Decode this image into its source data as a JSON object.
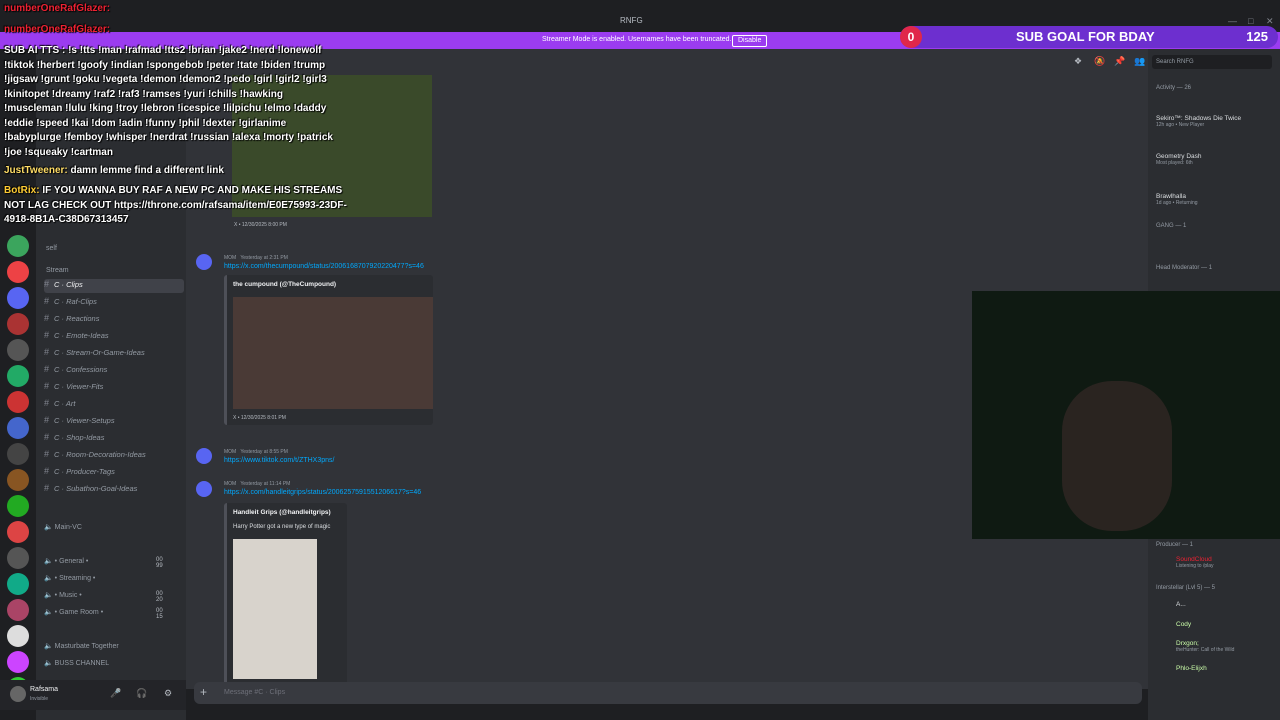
{
  "window": {
    "title": "RNFG"
  },
  "streamer_bar": {
    "message": "Streamer Mode is enabled. Usernames have been truncated.",
    "disable_label": "Disable"
  },
  "sub_goal": {
    "count": "0",
    "label": "SUB GOAL FOR BDAY",
    "target": "125"
  },
  "search": {
    "placeholder": "Search RNFG"
  },
  "stream_chat": [
    {
      "name": "numberOneRafGlazer:",
      "text": ""
    },
    {
      "name": "numberOneRafGlazer:",
      "text": ""
    },
    {
      "name": "",
      "text": "SUB AI TTS : !s !tts !man !rafmad !tts2 !brian !jake2 !nerd !lonewolf !tiktok !herbert !goofy !indian !spongebob !peter !tate !biden !trump !jigsaw !grunt !goku !vegeta !demon !demon2 !pedo !girl !girl2 !girl3 !kinitopet !dreamy !raf2 !raf3 !ramses !yuri !chills !hawking !muscleman !lulu !king !troy !lebron !icespice !lilpichu !elmo !daddy !eddie !speed !kai !dom !adin !funny !phil !dexter !girlanime !babyplurge !femboy !whisper !nerdrat !russian !alexa !morty !patrick !joe !squeaky !cartman"
    },
    {
      "name": "JustTweener:",
      "text": "damn lemme find a different link"
    },
    {
      "name": "BotRix:",
      "text": "IF YOU WANNA BUY RAF A NEW PC AND MAKE HIS STREAMS NOT LAG CHECK OUT https://throne.com/rafsama/item/E0E75993-23DF-4918-8B1A-C38D67313457"
    }
  ],
  "sidebar": {
    "self_label": "self",
    "stream_category": "Stream",
    "channels": [
      {
        "label": "C · Clips",
        "active": true
      },
      {
        "label": "C · Raf-Clips",
        "active": false
      },
      {
        "label": "C · Reactions",
        "active": false
      },
      {
        "label": "C · Emote-Ideas",
        "active": false
      },
      {
        "label": "C · Stream-Or-Game-Ideas",
        "active": false
      },
      {
        "label": "C · Confessions",
        "active": false
      },
      {
        "label": "C · Viewer-Fits",
        "active": false
      },
      {
        "label": "C · Art",
        "active": false
      },
      {
        "label": "C · Viewer-Setups",
        "active": false
      },
      {
        "label": "C · Shop-Ideas",
        "active": false
      },
      {
        "label": "C · Room-Decoration-Ideas",
        "active": false
      },
      {
        "label": "C · Producer-Tags",
        "active": false
      },
      {
        "label": "C · Subathon-Goal-Ideas",
        "active": false
      }
    ],
    "voice": [
      {
        "label": "Main-VC",
        "count": ""
      },
      {
        "label": "• General •",
        "count": "00  99"
      },
      {
        "label": "• Streaming •",
        "count": ""
      },
      {
        "label": "• Music •",
        "count": "00  20"
      },
      {
        "label": "• Game Room •",
        "count": "00  15"
      },
      {
        "label": "Masturbate Together",
        "count": ""
      },
      {
        "label": "BUSS CHANNEL",
        "count": ""
      }
    ],
    "user": {
      "name": "Rafsama",
      "status": "Invisible"
    }
  },
  "messages": [
    {
      "role": "MOM",
      "time": "Yesterday at 2:31 PM",
      "url": "https://x.com/thecumpound/status/2006168707920220477?s=46",
      "embed_title": "the cumpound (@TheCumpound)",
      "embed_footer": "X • 12/30/2025 8:01 PM"
    },
    {
      "role": "MOM",
      "time": "Yesterday at 8:55 PM",
      "url": "https://www.tiktok.com/t/ZTHX3pns/"
    },
    {
      "role": "MOM",
      "time": "Yesterday at 11:14 PM",
      "url": "https://x.com/handleitgrips/status/2006257591551206617?s=46",
      "embed_title": "Handleit Grips (@handleitgrips)",
      "embed_desc": "Harry Potter got a new type of magic"
    }
  ],
  "prev_embed_footer": "X • 12/30/2025 8:00 PM",
  "chat_input": {
    "placeholder": "Message #C · Clips"
  },
  "member_list": {
    "activity_header": "Activity — 26",
    "activities": [
      {
        "name": "Sekiro™: Shadows Die Twice",
        "detail": "12h ago • New Player"
      },
      {
        "name": "Geometry Dash",
        "detail": "Most played: 6th"
      },
      {
        "name": "Brawlhalla",
        "detail": "1d ago • Returning"
      }
    ],
    "gang_header": "GANG — 1",
    "head_mod_header": "Head Moderator — 1",
    "producer_header": "Producer — 1",
    "producer_member": {
      "name": "SoundCloud",
      "detail": "Listening to /play"
    },
    "interstellar_header": "Interstellar (Lvl 5) — 5",
    "members": [
      {
        "name": "A...",
        "detail": ""
      },
      {
        "name": "Cody",
        "detail": ""
      },
      {
        "name": "Drxgon;",
        "detail": "theHunter: Call of the Wild"
      },
      {
        "name": "Phlo-Elijxh",
        "detail": ""
      }
    ]
  },
  "colors": {
    "accent": "#9b3cf0",
    "link": "#00a8fc",
    "badge": "#e0274a"
  }
}
